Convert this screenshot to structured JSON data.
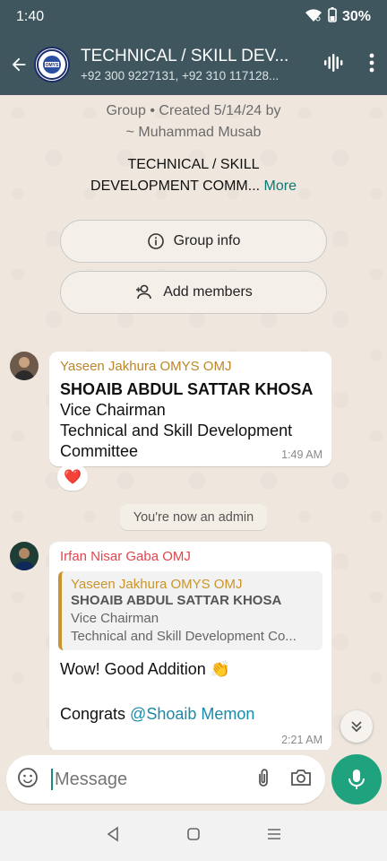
{
  "status": {
    "time": "1:40",
    "battery": "30%"
  },
  "header": {
    "title": "TECHNICAL / SKILL DEV...",
    "subtitle": "+92 300 9227131, +92 310 117128..."
  },
  "group": {
    "meta_line1": "Group • Created 5/14/24 by",
    "meta_line2": "~ Muhammad Musab",
    "desc_line1": "TECHNICAL / SKILL",
    "desc_line2": "DEVELOPMENT COMM...",
    "more": "More",
    "group_info_label": "Group info",
    "add_members_label": "Add members"
  },
  "messages": [
    {
      "sender": "Yaseen Jakhura OMYS OMJ",
      "sender_color": "#b9862a",
      "line1": "SHOAIB ABDUL SATTAR KHOSA",
      "line2": "Vice Chairman",
      "line3": "Technical and Skill Development",
      "line4": "Committee",
      "time": "1:49 AM",
      "reaction": "❤️"
    },
    {
      "sender": "Irfan Nisar Gaba OMJ",
      "sender_color": "#e0464f",
      "quote_sender": "Yaseen Jakhura OMYS OMJ",
      "quote_line1": "SHOAIB ABDUL SATTAR KHOSA",
      "quote_line2": "Vice Chairman",
      "quote_line3": "Technical and Skill Development Co...",
      "text1": "Wow! Good Addition 👏",
      "text2_prefix": "Congrats ",
      "mention": "@Shoaib Memon",
      "time": "2:21 AM"
    }
  ],
  "system_message": "You're now an admin",
  "composer": {
    "placeholder": "Message"
  },
  "colors": {
    "header": "#3f565e",
    "accent": "#1fa37e",
    "chat_bg": "#efe7de"
  }
}
